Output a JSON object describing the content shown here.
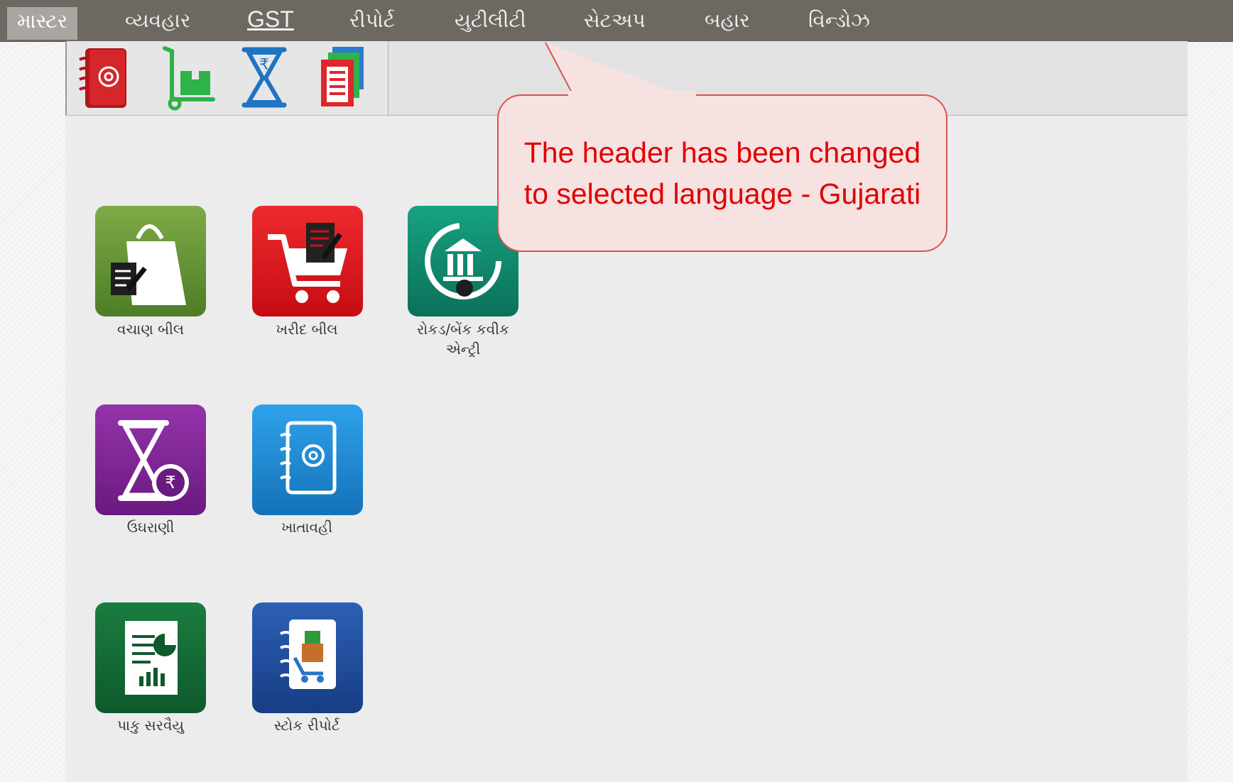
{
  "menu": {
    "items": [
      {
        "label": "માસ્ટર",
        "active": true
      },
      {
        "label": "વ્યવહાર"
      },
      {
        "label": "GST"
      },
      {
        "label": "રીપોર્ટ"
      },
      {
        "label": "યુટીલીટી"
      },
      {
        "label": "સેટઅપ"
      },
      {
        "label": "બહાર"
      },
      {
        "label": "વિન્ડોઝ"
      }
    ]
  },
  "toolbar": {
    "buttons": [
      {
        "icon": "address-book-icon"
      },
      {
        "icon": "trolley-icon"
      },
      {
        "icon": "hourglass-rupee-icon"
      },
      {
        "icon": "report-stack-icon"
      }
    ]
  },
  "tiles": [
    {
      "label": "વચાણ બીલ",
      "icon": "shopping-bag-icon",
      "color": "#5f8f2e"
    },
    {
      "label": "ખરીદ બીલ",
      "icon": "shopping-cart-icon",
      "color": "#d8141b"
    },
    {
      "label_line1": "રોકડ/બેંક કવીક",
      "label_line2": "એન્ટ્રી",
      "icon": "bank-icon",
      "color": "#0f8a6d"
    },
    {
      "label": "ઉઘરાણી",
      "icon": "hourglass-rupee-icon",
      "color": "#7b2490"
    },
    {
      "label": "ખાતાવહી",
      "icon": "ledger-icon",
      "color": "#1a8ad6"
    },
    {
      "label": "પાકુ સરવૈયુ",
      "icon": "balance-sheet-icon",
      "color": "#136b35"
    },
    {
      "label": "સ્ટોક રીપોર્ટ",
      "icon": "stock-report-icon",
      "color": "#1e4b9c"
    }
  ],
  "callout": {
    "line1": "The header has been changed",
    "line2": "to selected language - Gujarati"
  },
  "colors": {
    "menubar": "#6e6863",
    "callout_border": "#d9534f",
    "callout_fill": "#f7e2e2",
    "callout_text": "#e00000"
  }
}
